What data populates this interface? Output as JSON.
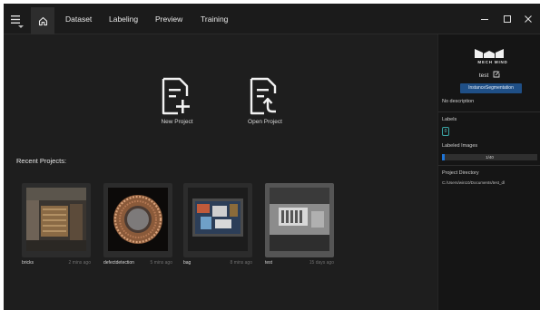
{
  "titlebar": {
    "tabs": [
      {
        "label": "Dataset"
      },
      {
        "label": "Labeling"
      },
      {
        "label": "Preview"
      },
      {
        "label": "Training"
      }
    ],
    "icons": {
      "menu": "hamburger-icon",
      "home": "home-icon",
      "minimize": "minimize-icon",
      "maximize": "maximize-icon",
      "close": "close-icon"
    }
  },
  "actions": {
    "new_project": "New Project",
    "open_project": "Open Project"
  },
  "recent": {
    "title": "Recent Projects:",
    "projects": [
      {
        "name": "bricks",
        "age": "2 mins ago"
      },
      {
        "name": "defectdetection",
        "age": "5 mins ago"
      },
      {
        "name": "bag",
        "age": "8 mins ago"
      },
      {
        "name": "test",
        "age": "15 days ago",
        "selected": true
      }
    ]
  },
  "panel": {
    "logo_text": "MECH MIND",
    "project_name": "test",
    "project_type": "InstanceSegmentation",
    "description": "No description",
    "labels_title": "Labels",
    "label_count": "0",
    "labeled_images_title": "Labeled Images",
    "labeled_progress_text": "1/40",
    "labeled_progress": 0.025,
    "project_dir_title": "Project Directory",
    "project_dir_path": "C:/Users/win10/Documents/test_dl"
  },
  "colors": {
    "accent": "#1e74d6",
    "badge": "#1f4f86",
    "label_chip": "#3aa4a4",
    "background": "#1e1e1e",
    "panel": "#151515"
  }
}
